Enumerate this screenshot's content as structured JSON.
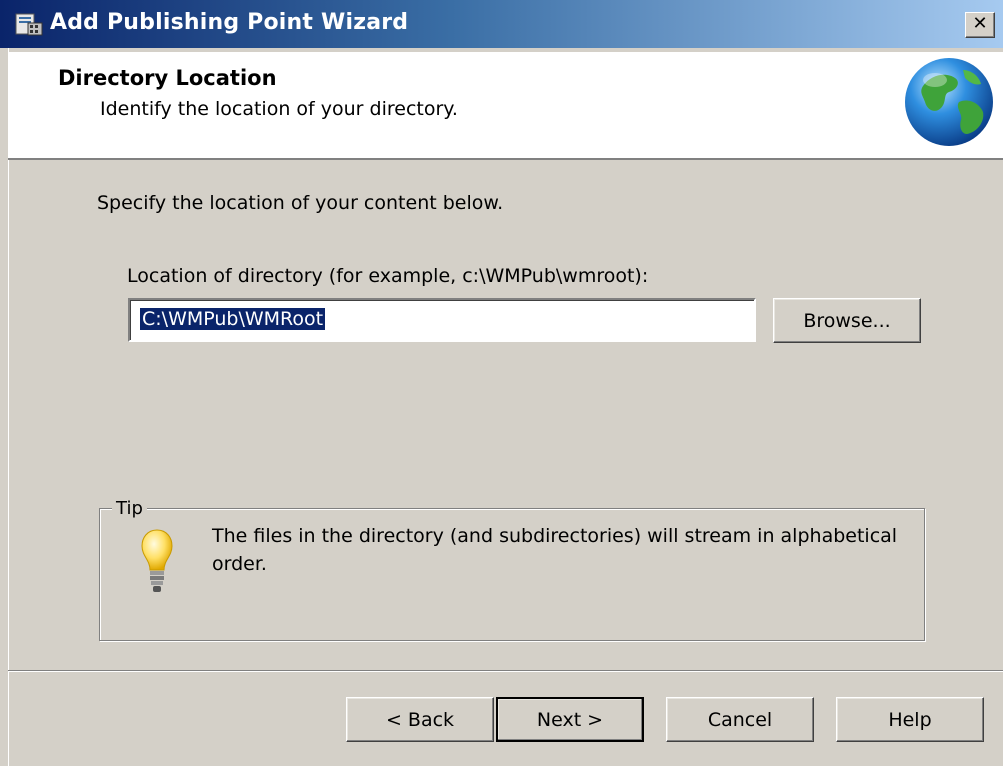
{
  "window": {
    "title": "Add Publishing Point Wizard",
    "close_glyph": "✕"
  },
  "header": {
    "title": "Directory Location",
    "subtitle": "Identify the location of your directory.",
    "icon": "globe-icon"
  },
  "content": {
    "instruction": "Specify the location of your content below.",
    "location_label": "Location of directory (for example, c:\\WMPub\\wmroot):",
    "location_value": "C:\\WMPub\\WMRoot",
    "browse_label": "Browse..."
  },
  "tip": {
    "legend": "Tip",
    "text": "The files in the directory (and subdirectories) will stream in alphabetical order.",
    "icon": "lightbulb-icon"
  },
  "buttons": {
    "back": "< Back",
    "next": "Next >",
    "cancel": "Cancel",
    "help": "Help"
  }
}
